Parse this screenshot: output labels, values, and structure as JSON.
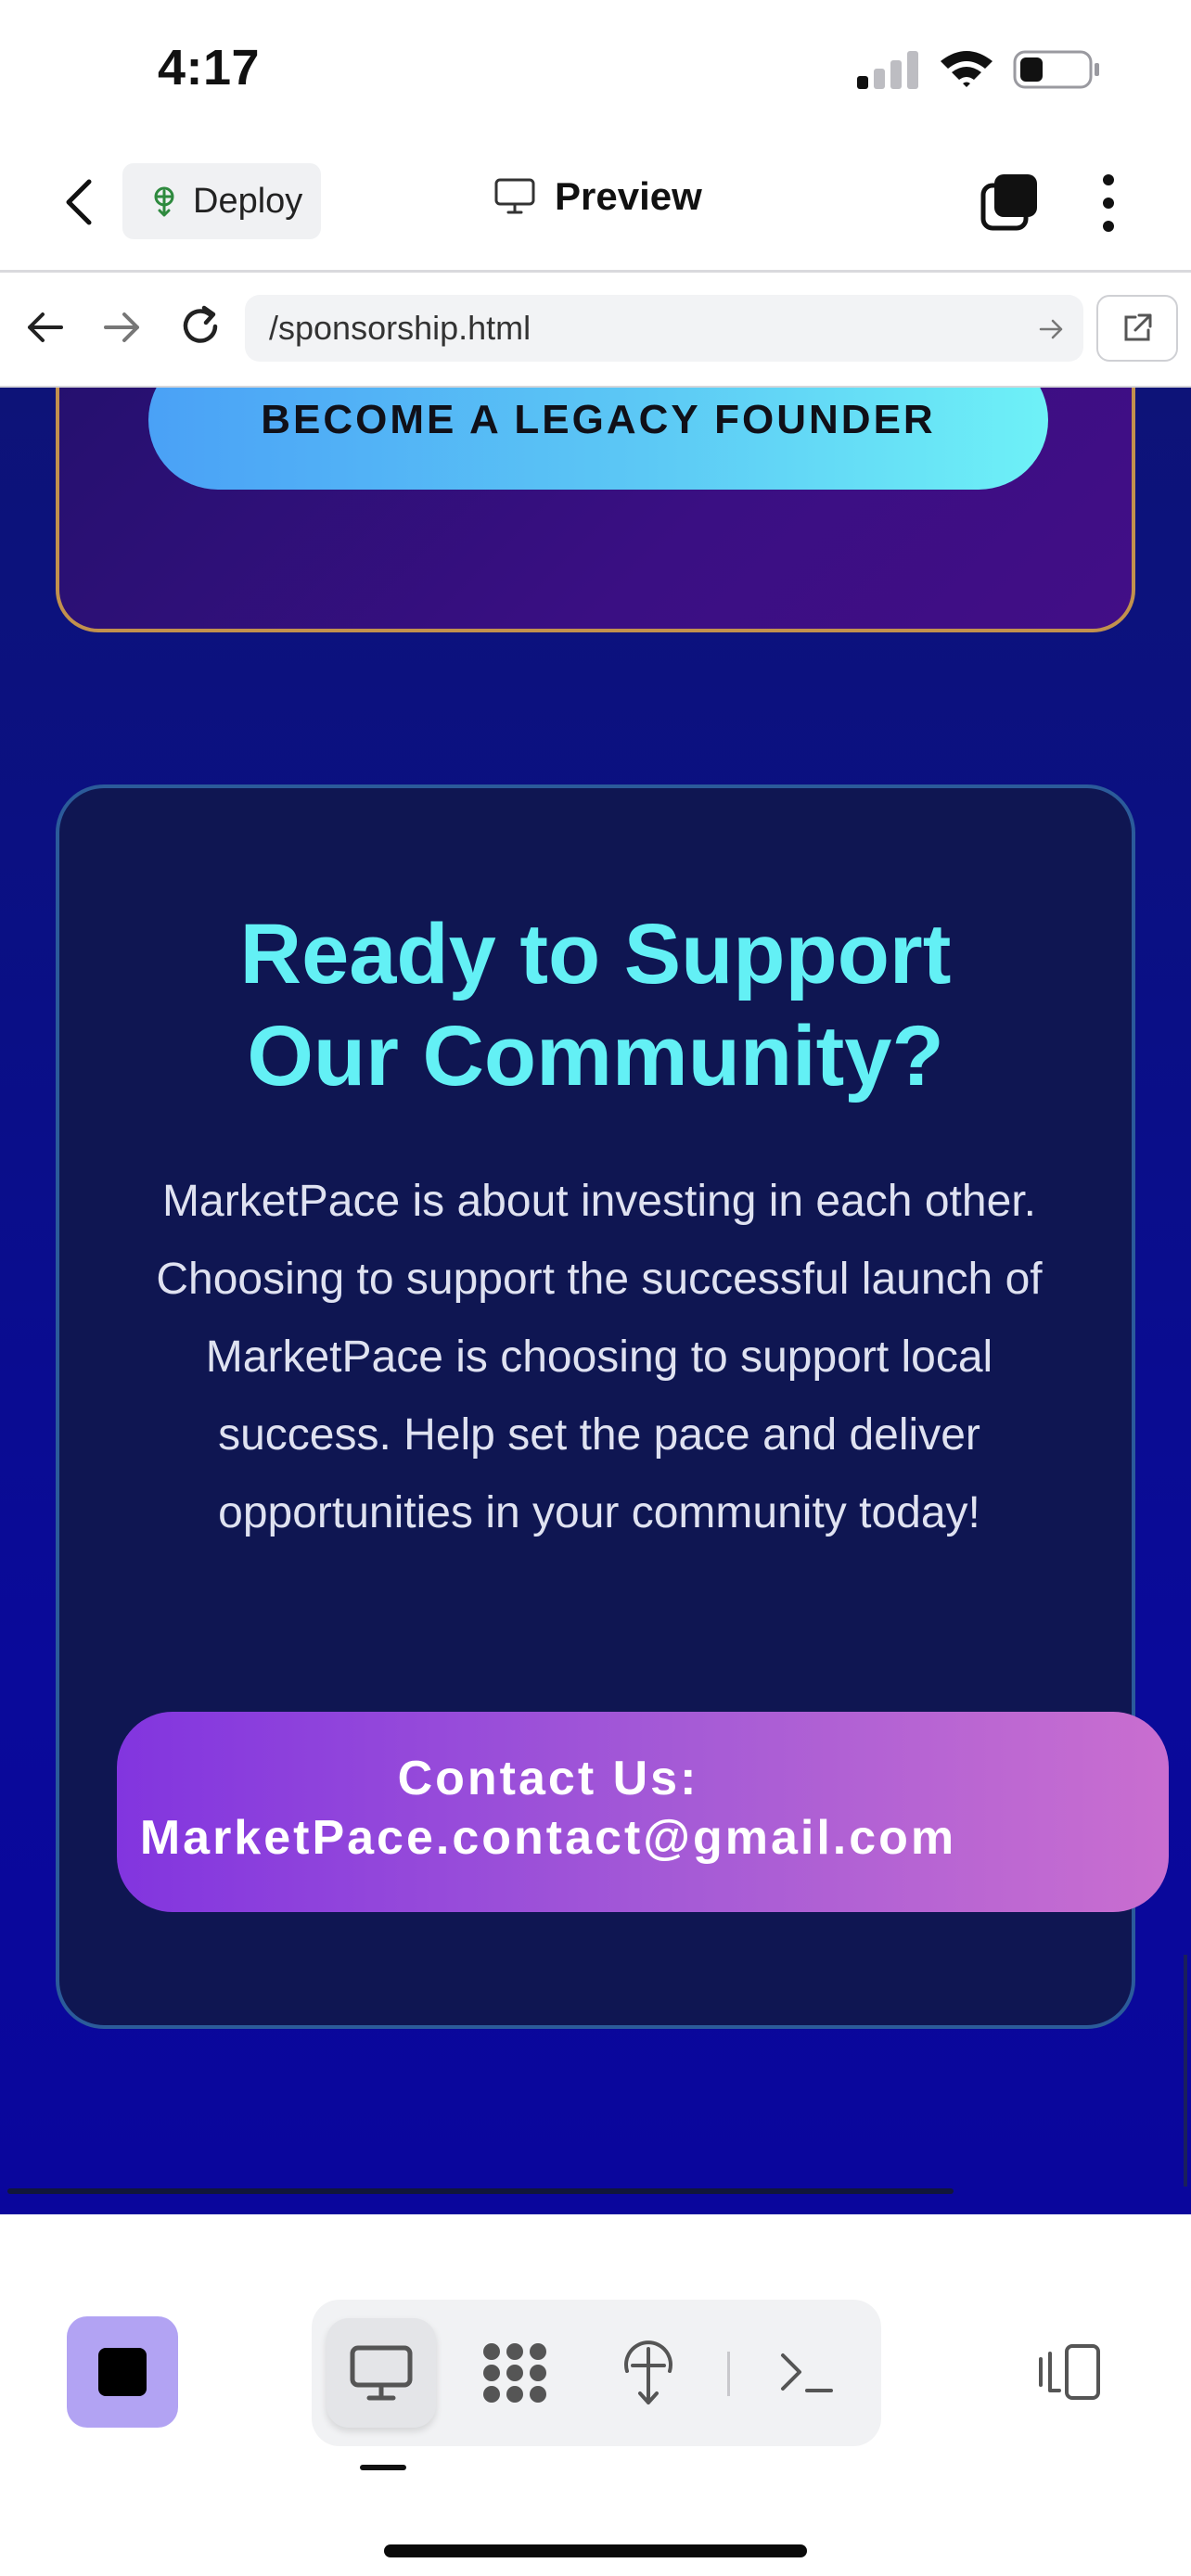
{
  "status_bar": {
    "time": "4:17"
  },
  "app_bar": {
    "deploy_label": "Deploy",
    "preview_label": "Preview"
  },
  "browser": {
    "url": "/sponsorship.html"
  },
  "page": {
    "legacy_button": "BECOME A LEGACY FOUNDER",
    "support_title_line1": "Ready to Support",
    "support_title_line2": "Our Community?",
    "support_body": "MarketPace is about investing in each other. Choosing to support the successful launch of MarketPace is choosing to support local success. Help set the pace and deliver opportunities in your community today!",
    "contact_line1": "Contact Us:",
    "contact_line2": "MarketPace.contact@gmail.com"
  },
  "colors": {
    "title_cyan": "#63f0f5",
    "contact_purple": "#8235df",
    "legacy_gold_border": "#c2914d",
    "stop_button_bg": "#b2a3f3"
  },
  "icons": [
    "signal-icon",
    "wifi-icon",
    "battery-icon",
    "back-chevron-icon",
    "deploy-icon",
    "monitor-icon",
    "tabs-icon",
    "more-icon",
    "arrow-left-icon",
    "arrow-right-icon",
    "reload-icon",
    "open-external-icon",
    "stop-icon",
    "desktop-icon",
    "grid-icon",
    "deploy-antenna-icon",
    "terminal-icon",
    "layout-icon"
  ]
}
